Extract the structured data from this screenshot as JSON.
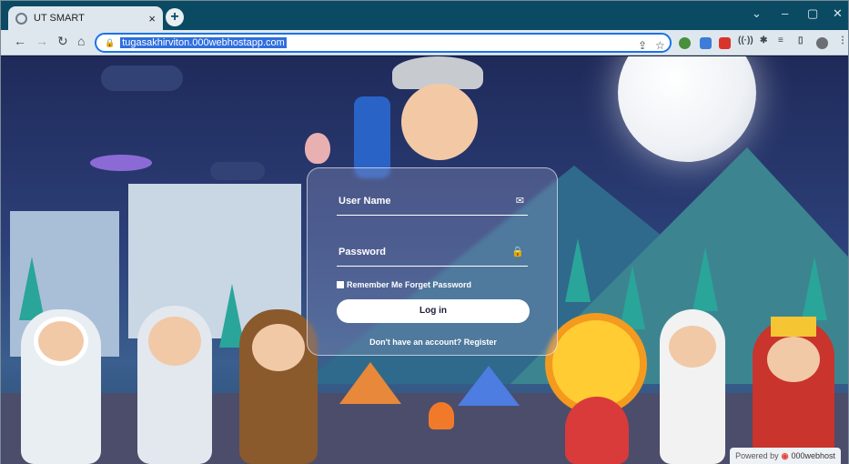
{
  "tab": {
    "title": "UT SMART",
    "close": "×",
    "new_tab": "+"
  },
  "window_controls": {
    "dropdown": "⌄",
    "minimize": "–",
    "maximize": "▢",
    "close": "✕"
  },
  "toolbar": {
    "back": "←",
    "forward": "→",
    "reload": "↻",
    "home": "⌂",
    "url": "tugasakhirviton.000webhostapp.com"
  },
  "login": {
    "username_label": "User Name",
    "password_label": "Password",
    "remember_label": "Remember Me Forget Password",
    "login_button": "Log in",
    "register_text": "Don't have an account? Register"
  },
  "badge": {
    "powered_by": "Powered by",
    "brand": "000webhost"
  },
  "colors": {
    "accent": "#1a73e8",
    "tabstrip": "#0b4a63",
    "toolbar": "#dfe7ee"
  },
  "icons": {
    "email": "mail-icon",
    "password": "lock-icon"
  }
}
